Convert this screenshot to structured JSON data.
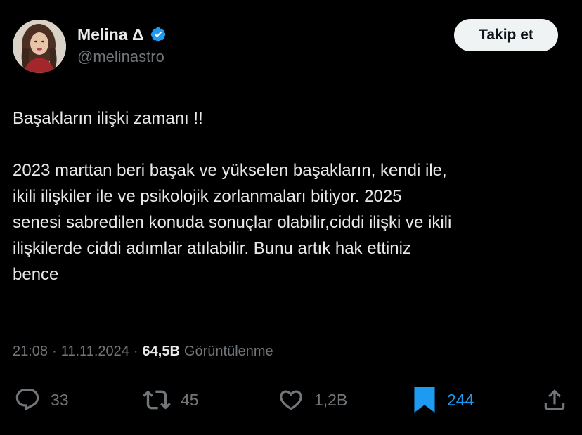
{
  "author": {
    "display_name": "Melina Δ",
    "handle": "@melinastro",
    "verified": true,
    "verified_color": "#1d9bf0"
  },
  "follow_button": {
    "label": "Takip et"
  },
  "tweet": {
    "paragraphs": [
      "Başakların ilişki zamanı !!",
      "",
      "2023 marttan beri başak ve yükselen başakların, kendi ile,",
      "ikili ilişkiler ile ve psikolojik zorlanmaları bitiyor. 2025",
      "senesi sabredilen konuda sonuçlar olabilir,ciddi ilişki ve ikili",
      "ilişkilerde ciddi adımlar atılabilir. Bunu artık hak ettiniz",
      "bence"
    ]
  },
  "meta": {
    "time": "21:08",
    "separator": "·",
    "date": "11.11.2024",
    "views_count": "64,5B",
    "views_label": "Görüntülenme"
  },
  "actions": {
    "reply": {
      "icon": "reply-icon",
      "count": "33"
    },
    "retweet": {
      "icon": "retweet-icon",
      "count": "45"
    },
    "like": {
      "icon": "heart-icon",
      "count": "1,2B"
    },
    "bookmark": {
      "icon": "bookmark-filled-icon",
      "count": "244",
      "active": true
    },
    "share": {
      "icon": "share-icon"
    }
  },
  "colors": {
    "background": "#000000",
    "text_primary": "#e7e9ea",
    "text_secondary": "#71767b",
    "accent": "#1d9bf0",
    "follow_bg": "#eff3f4"
  }
}
